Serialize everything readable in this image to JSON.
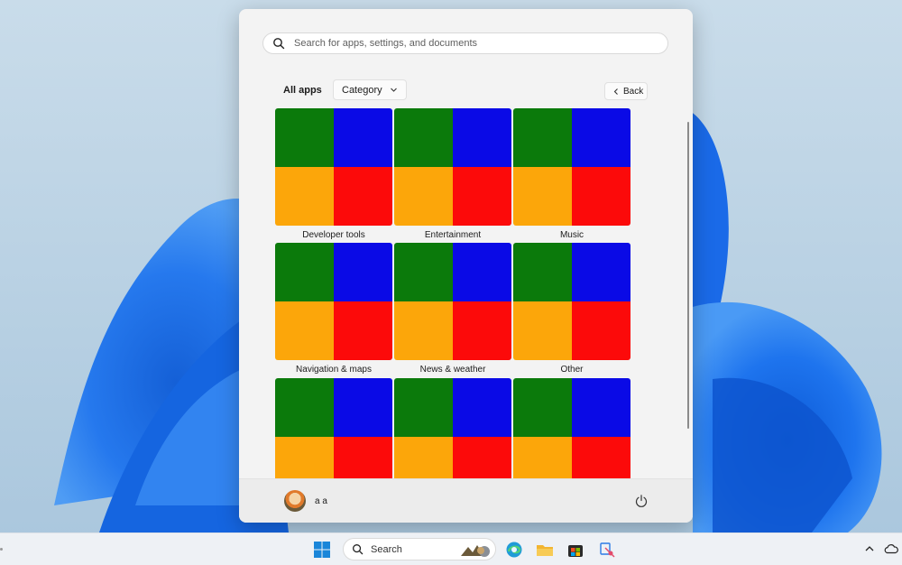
{
  "search": {
    "placeholder": "Search for apps, settings, and documents"
  },
  "header": {
    "all_apps": "All apps",
    "category": "Category",
    "back": "Back"
  },
  "tile_colors": {
    "top_left": "#0b7a0b",
    "top_right": "#0a0ae6",
    "bottom_left": "#fca60a",
    "bottom_right": "#fc0a0a"
  },
  "categories": [
    {
      "label": "Developer tools"
    },
    {
      "label": "Entertainment"
    },
    {
      "label": "Music"
    },
    {
      "label": "Navigation & maps"
    },
    {
      "label": "News & weather"
    },
    {
      "label": "Other"
    },
    {
      "label": ""
    },
    {
      "label": ""
    },
    {
      "label": ""
    }
  ],
  "user": {
    "name": "a a"
  },
  "taskbar": {
    "search_label": "Search"
  }
}
